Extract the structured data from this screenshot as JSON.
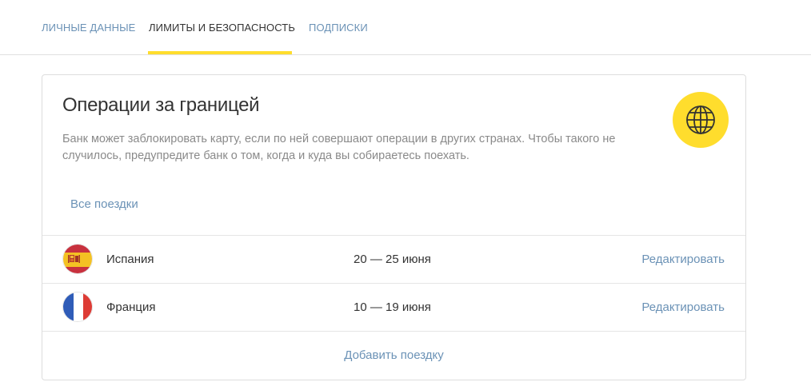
{
  "tabs": [
    {
      "label": "Личные данные",
      "active": false
    },
    {
      "label": "Лимиты и безопасность",
      "active": true
    },
    {
      "label": "Подписки",
      "active": false
    }
  ],
  "card": {
    "title": "Операции за границей",
    "description": "Банк может заблокировать карту, если по ней совершают операции в других странах. Чтобы такого не случилось, предупредите банк о том, когда и куда вы собираетесь поехать.",
    "icon": "globe-icon",
    "all_trips_label": "Все поездки",
    "trips": [
      {
        "country": "Испания",
        "dates": "20 — 25 июня",
        "edit_label": "Редактировать",
        "flag": "spain-flag-icon"
      },
      {
        "country": "Франция",
        "dates": "10 — 19 июня",
        "edit_label": "Редактировать",
        "flag": "france-flag-icon"
      }
    ],
    "add_trip_label": "Добавить поездку"
  },
  "colors": {
    "accent_yellow": "#ffdd2d",
    "link_blue": "#6b92b6",
    "text_dark": "#333333",
    "text_muted": "#8a8a8a"
  }
}
